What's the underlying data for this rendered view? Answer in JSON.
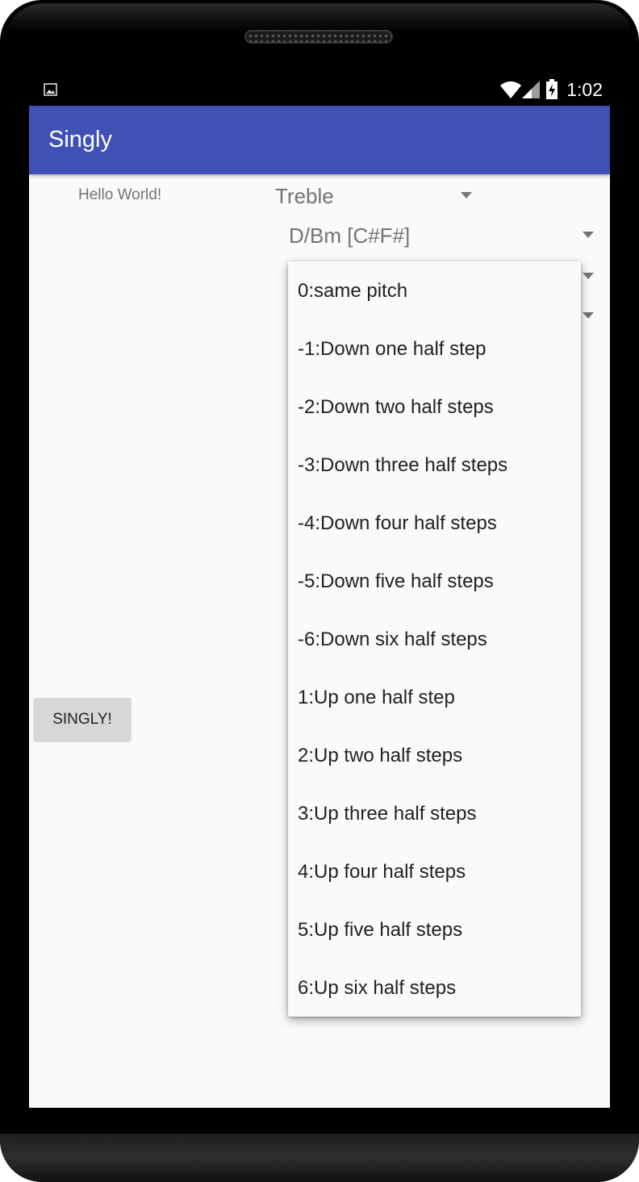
{
  "status_bar": {
    "time": "1:02",
    "icons": [
      "image-icon",
      "wifi-icon",
      "cell-signal-icon",
      "battery-charging-icon"
    ]
  },
  "app_bar": {
    "title": "Singly"
  },
  "content": {
    "hello_text": "Hello World!",
    "clef_spinner": {
      "selected": "Treble"
    },
    "key_spinner": {
      "selected": "D/Bm [C#F#]"
    },
    "button_label": "SINGLY!"
  },
  "transpose_dropdown": {
    "options": [
      "0:same pitch",
      "-1:Down one half step",
      "-2:Down two half steps",
      "-3:Down three half steps",
      "-4:Down four half steps",
      "-5:Down five half steps",
      "-6:Down six half steps",
      "1:Up one half step",
      "2:Up two half steps",
      "3:Up three half steps",
      "4:Up four half steps",
      "5:Up five half steps",
      "6:Up six half steps"
    ]
  },
  "colors": {
    "primary": "#3f51b5",
    "background": "#fafafa",
    "button": "#d6d7d7"
  }
}
